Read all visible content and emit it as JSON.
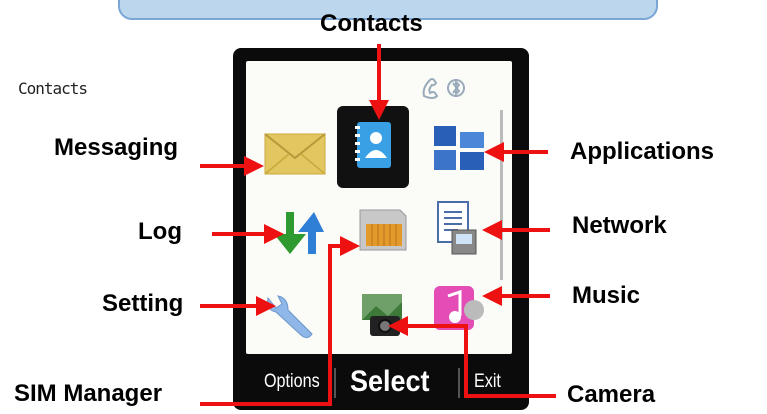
{
  "callouts": {
    "contacts": "Contacts",
    "messaging": "Messaging",
    "applications": "Applications",
    "log": "Log",
    "network": "Network",
    "setting": "Setting",
    "music": "Music",
    "sim_manager": "SIM Manager",
    "camera": "Camera"
  },
  "screen": {
    "title": "Contacts",
    "soft_keys": {
      "left": "Options",
      "middle": "Select",
      "right": "Exit"
    },
    "icons": [
      "envelope-icon",
      "contacts-book-icon",
      "apps-grid-icon",
      "call-log-arrows-icon",
      "sim-card-icon",
      "network-document-icon",
      "wrench-icon",
      "camera-icon",
      "music-note-icon"
    ],
    "selected": "Contacts"
  },
  "colors": {
    "arrow": "#ee1111",
    "screen_bg": "#fbfbf8",
    "bezel": "#0b0b0b",
    "banner": "#bcd6ee"
  }
}
